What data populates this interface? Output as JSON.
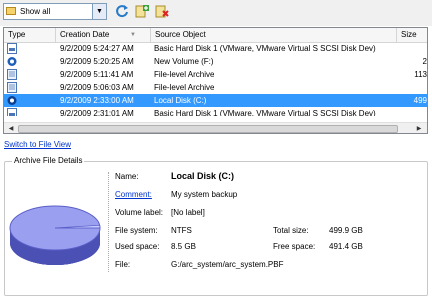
{
  "toolbar": {
    "filter_value": "Show all",
    "icons": [
      "refresh-icon",
      "add-icon",
      "delete-icon"
    ]
  },
  "list": {
    "columns": [
      "Type",
      "Creation Date",
      "Source Object",
      "Size"
    ],
    "rows": [
      {
        "date": "9/2/2009 5:24:27 AM",
        "source": "Basic Hard Disk 1 (VMware, VMware Virtual S SCSI Disk Dev)",
        "size": "",
        "icon": "disk-archive-icon"
      },
      {
        "date": "9/2/2009 5:20:25 AM",
        "source": "New Volume (F:)",
        "size": "2",
        "icon": "volume-archive-icon"
      },
      {
        "date": "9/2/2009 5:11:41 AM",
        "source": "File-level Archive",
        "size": "113",
        "icon": "file-archive-icon"
      },
      {
        "date": "9/2/2009 5:06:03 AM",
        "source": "File-level Archive",
        "size": "",
        "icon": "file-archive-icon"
      },
      {
        "date": "9/2/2009 2:33:00 AM",
        "source": "Local Disk (C:)",
        "size": "499",
        "icon": "volume-archive-icon",
        "selected": true
      },
      {
        "date": "9/2/2009 2:31:01 AM",
        "source": "Basic Hard Disk 1 (VMware, VMware Virtual S SCSI Disk Dev)",
        "size": "",
        "icon": "disk-archive-icon"
      }
    ]
  },
  "switch_link": "Switch to File View",
  "details": {
    "group_title": "Archive File Details",
    "name_label": "Name:",
    "name_value": "Local Disk (C:)",
    "comment_label": "Comment:",
    "comment_value": "My system backup",
    "volume_label_label": "Volume label:",
    "volume_label_value": "[No label]",
    "file_system_label": "File system:",
    "file_system_value": "NTFS",
    "total_size_label": "Total size:",
    "total_size_value": "499.9 GB",
    "used_space_label": "Used space:",
    "used_space_value": "8.5 GB",
    "free_space_label": "Free space:",
    "free_space_value": "491.4 GB",
    "file_label": "File:",
    "file_value": "G:/arc_system/arc_system.PBF",
    "used_fraction": 0.017
  }
}
